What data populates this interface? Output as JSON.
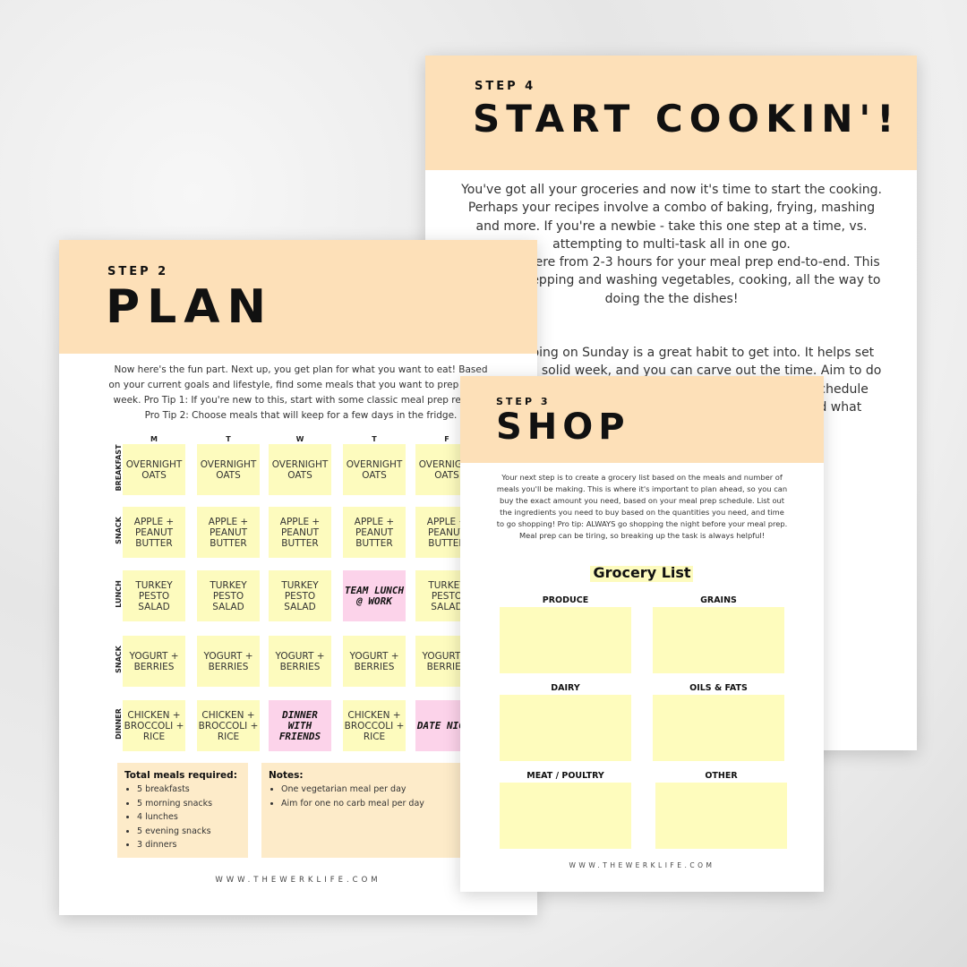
{
  "step4": {
    "step": "STEP 4",
    "title": "START COOKIN'!",
    "paragraphs": [
      "You've got all your groceries and now it's time to start the cooking. Perhaps your recipes involve a combo of baking, frying, mashing and more. If you're a newbie - take this one step at a time, vs. attempting to multi-task all in one go.",
      "Plan anywhere from 2-3 hours for your meal prep end-to-end. This includes prepping and washing vegetables, cooking, all the way to doing the the dishes!",
      "Meal prepping on Sunday is a great habit to get into. It helps set you up for a solid week, and you can carve out the time. Aim to do your cooking at a time that suits you, and make your schedule work for you, which might be different each week. Find what works for you a"
    ]
  },
  "step2": {
    "step": "STEP 2",
    "title": "PLAN",
    "intro": "Now here's the fun part. Next up, you get plan for what you want to eat! Based on your current goals and lifestyle, find some meals that you want to prep for the week. Pro Tip 1: If you're new to this, start with some classic meal prep recipes. Pro Tip 2: Choose meals that will keep for a few days in the fridge.",
    "days": [
      "M",
      "T",
      "W",
      "T",
      "F"
    ],
    "rows": [
      {
        "label": "BREAKFAST",
        "cells": [
          "OVERNIGHT OATS",
          "OVERNIGHT OATS",
          "OVERNIGHT OATS",
          "OVERNIGHT OATS",
          "OVERNIGHT OATS"
        ]
      },
      {
        "label": "SNACK",
        "cells": [
          "APPLE + PEANUT BUTTER",
          "APPLE + PEANUT BUTTER",
          "APPLE + PEANUT BUTTER",
          "APPLE + PEANUT BUTTER",
          "APPLE + PEANUT BUTTER"
        ]
      },
      {
        "label": "LUNCH",
        "cells": [
          "TURKEY PESTO SALAD",
          "TURKEY PESTO SALAD",
          "TURKEY PESTO SALAD",
          "TEAM LUNCH @ WORK",
          "TURKEY PESTO SALAD"
        ]
      },
      {
        "label": "SNACK",
        "cells": [
          "YOGURT + BERRIES",
          "YOGURT + BERRIES",
          "YOGURT + BERRIES",
          "YOGURT + BERRIES",
          "YOGURT + BERRIES"
        ]
      },
      {
        "label": "DINNER",
        "cells": [
          "CHICKEN + BROCCOLI + RICE",
          "CHICKEN + BROCCOLI + RICE",
          "DINNER WITH FRIENDS",
          "CHICKEN + BROCCOLI + RICE",
          "DATE NIGHT"
        ]
      }
    ],
    "special_cells": [
      "TEAM LUNCH @ WORK",
      "DINNER WITH FRIENDS",
      "DATE NIGHT"
    ],
    "totals": {
      "title": "Total meals required:",
      "items": [
        "5 breakfasts",
        "5 morning snacks",
        "4 lunches",
        "5 evening snacks",
        "3 dinners"
      ]
    },
    "notes": {
      "title": "Notes:",
      "items": [
        "One vegetarian meal per day",
        "Aim for one no carb meal per day"
      ]
    },
    "footer": "WWW.THEWERKLIFE.COM"
  },
  "step3": {
    "step": "STEP 3",
    "title": "SHOP",
    "intro": "Your next step is to create a grocery list based on the meals and number of meals you'll be making. This is where it's important to plan ahead, so you can buy the exact amount you need, based on your meal prep schedule. List out the ingredients you need to buy based on the quantities you need, and time to go shopping! Pro tip: ALWAYS go shopping the night before your meal prep. Meal prep can be tiring, so breaking up the task is always helpful!",
    "list_title": "Grocery List",
    "categories": [
      "PRODUCE",
      "GRAINS",
      "DAIRY",
      "OILS & FATS",
      "MEAT / POULTRY",
      "OTHER"
    ],
    "footer": "WWW.THEWERKLIFE.COM"
  },
  "colors": {
    "header": "#fde0b8",
    "cell": "#fdfbbe",
    "special_cell": "#fcd3ea",
    "summary_box": "#fdebc9",
    "grocery_box": "#fefcbd"
  }
}
